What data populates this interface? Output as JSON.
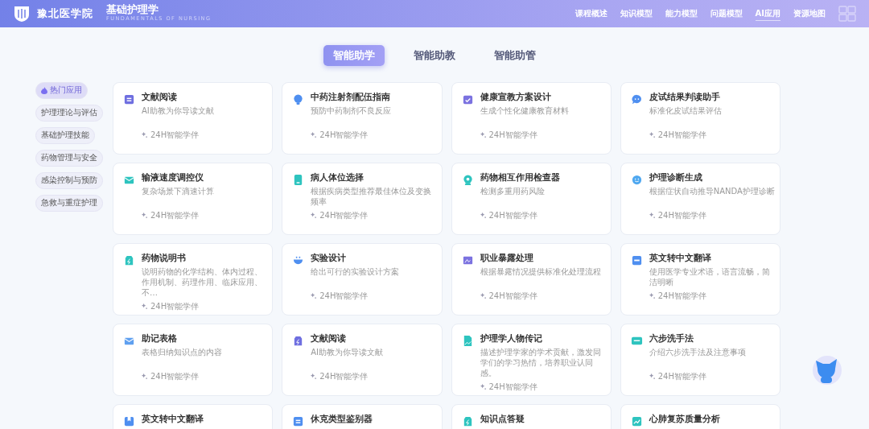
{
  "header": {
    "school": "豫北医学院",
    "course": "基础护理学",
    "course_en": "FUNDAMENTALS OF NURSING",
    "nav": [
      {
        "label": "课程概述",
        "selected": false
      },
      {
        "label": "知识模型",
        "selected": false
      },
      {
        "label": "能力模型",
        "selected": false
      },
      {
        "label": "问题模型",
        "selected": false
      },
      {
        "label": "AI应用",
        "selected": true
      },
      {
        "label": "资源地图",
        "selected": false
      }
    ]
  },
  "tabs": [
    {
      "label": "智能助学",
      "selected": true
    },
    {
      "label": "智能助教",
      "selected": false
    },
    {
      "label": "智能助管",
      "selected": false
    }
  ],
  "sidebar": {
    "items": [
      {
        "label": "热门应用",
        "selected": true
      },
      {
        "label": "护理理论与评估",
        "selected": false
      },
      {
        "label": "基础护理技能",
        "selected": false
      },
      {
        "label": "药物管理与安全",
        "selected": false
      },
      {
        "label": "感染控制与预防",
        "selected": false
      },
      {
        "label": "急救与重症护理",
        "selected": false
      }
    ]
  },
  "cards": [
    {
      "title": "文献阅读",
      "desc": "AI助教为你导读文献",
      "tag": "24H智能学伴",
      "kind": "document",
      "color": "#6f6fe0"
    },
    {
      "title": "中药注射剂配伍指南",
      "desc": "预防中药制剂不良反应",
      "tag": "24H智能学伴",
      "kind": "bulb",
      "color": "#4f8ff0"
    },
    {
      "title": "健康宣教方案设计",
      "desc": "生成个性化健康教育材料",
      "tag": "24H智能学伴",
      "kind": "calendar",
      "color": "#7b72e0"
    },
    {
      "title": "皮试结果判读助手",
      "desc": "标准化皮试结果评估",
      "tag": "24H智能学伴",
      "kind": "chat",
      "color": "#4f8ff0"
    },
    {
      "title": "输液速度调控仪",
      "desc": "复杂场景下滴速计算",
      "tag": "24H智能学伴",
      "kind": "mail",
      "color": "#2ec4bf"
    },
    {
      "title": "病人体位选择",
      "desc": "根据疾病类型推荐最佳体位及变换频率",
      "tag": "24H智能学伴",
      "kind": "tablet",
      "color": "#2ec4bf"
    },
    {
      "title": "药物相互作用检查器",
      "desc": "检测多重用药风险",
      "tag": "24H智能学伴",
      "kind": "medal",
      "color": "#2ec4bf"
    },
    {
      "title": "护理诊断生成",
      "desc": "根据症状自动推导NANDA护理诊断",
      "tag": "24H智能学伴",
      "kind": "smile",
      "color": "#4fa8f0"
    },
    {
      "title": "药物说明书",
      "desc": "说明药物的化学结构、体内过程、作用机制、药理作用、临床应用、不…",
      "tag": "24H智能学伴",
      "kind": "bag",
      "color": "#2ec4bf"
    },
    {
      "title": "实验设计",
      "desc": "给出可行的实验设计方案",
      "tag": "24H智能学伴",
      "kind": "cup",
      "color": "#4f8ff0"
    },
    {
      "title": "职业暴露处理",
      "desc": "根据暴露情况提供标准化处理流程",
      "tag": "24H智能学伴",
      "kind": "frame",
      "color": "#7b72e0"
    },
    {
      "title": "英文转中文翻译",
      "desc": "使用医学专业术语，语言流畅，简洁明晰",
      "tag": "24H智能学伴",
      "kind": "numbers",
      "color": "#4f8ff0"
    },
    {
      "title": "助记表格",
      "desc": "表格归纳知识点的内容",
      "tag": "24H智能学伴",
      "kind": "mail",
      "color": "#5fa0f0"
    },
    {
      "title": "文献阅读",
      "desc": "AI助教为你导读文献",
      "tag": "24H智能学伴",
      "kind": "bag",
      "color": "#6f6fe0"
    },
    {
      "title": "护理学人物传记",
      "desc": "描述护理学家的学术贡献，激发同学们的学习热情，培养职业认同感。",
      "tag": "24H智能学伴",
      "kind": "image",
      "color": "#2ec4bf"
    },
    {
      "title": "六步洗手法",
      "desc": "介绍六步洗手法及注意事项",
      "tag": "24H智能学伴",
      "kind": "screen",
      "color": "#2ec4bf"
    },
    {
      "title": "英文转中文翻译",
      "kind": "bookmark",
      "color": "#4f8ff0"
    },
    {
      "title": "休克类型鉴别器",
      "kind": "document",
      "color": "#4f8ff0"
    },
    {
      "title": "知识点答疑",
      "kind": "bag",
      "color": "#2ec4bf"
    },
    {
      "title": "心肺复苏质量分析",
      "kind": "chart",
      "color": "#2ec4bf"
    }
  ]
}
